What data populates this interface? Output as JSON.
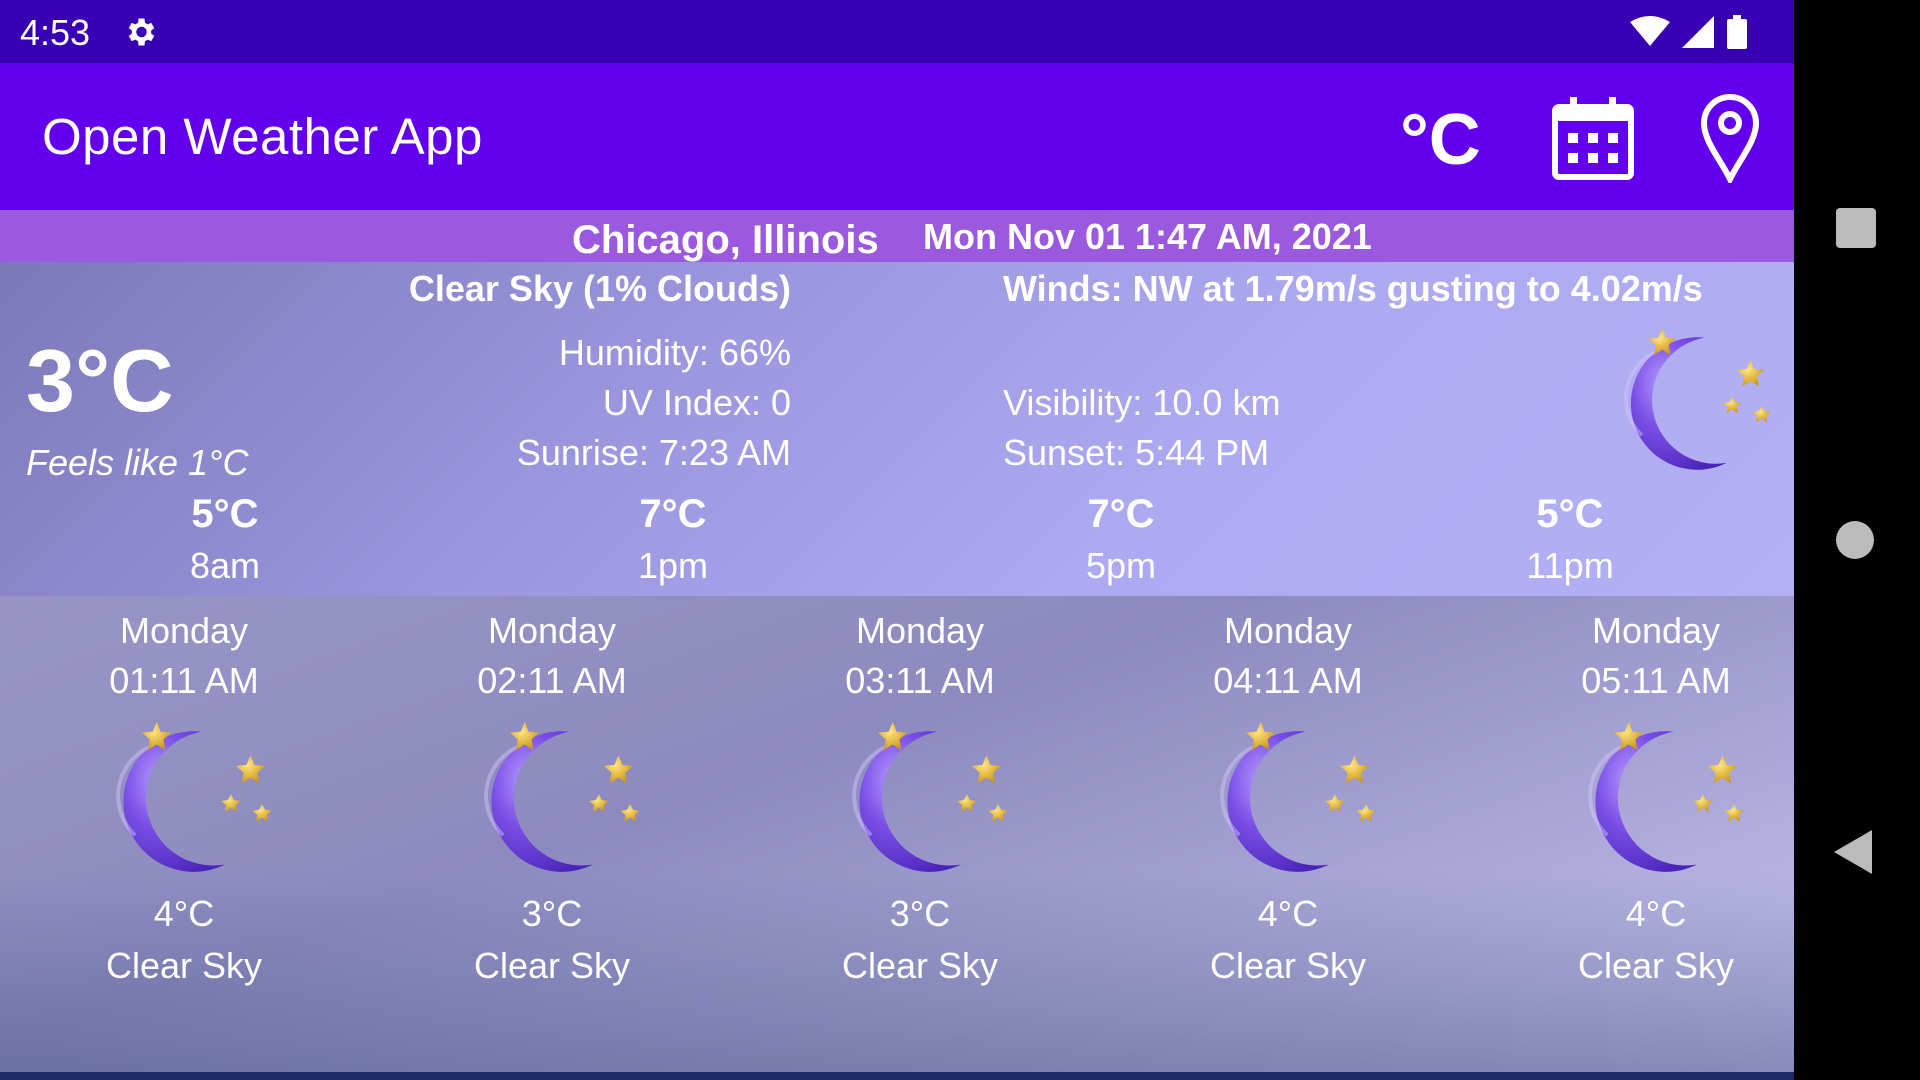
{
  "status_bar": {
    "time": "4:53"
  },
  "app_bar": {
    "title": "Open Weather App",
    "unit_label": "°C"
  },
  "location": {
    "city": "Chicago, Illinois",
    "datetime": "Mon Nov 01 1:47 AM, 2021"
  },
  "current": {
    "condition": "Clear Sky (1% Clouds)",
    "winds": "Winds: NW at 1.79m/s gusting to 4.02m/s",
    "temperature": "3°C",
    "feels_like": "Feels like 1°C",
    "humidity": "Humidity: 66%",
    "uv_index": "UV Index: 0",
    "sunrise": "Sunrise: 7:23 AM",
    "visibility": "Visibility: 10.0 km",
    "sunset": "Sunset: 5:44 PM",
    "icon": "moon-stars-icon"
  },
  "day_parts": [
    {
      "temp": "5°C",
      "label": "8am"
    },
    {
      "temp": "7°C",
      "label": "1pm"
    },
    {
      "temp": "7°C",
      "label": "5pm"
    },
    {
      "temp": "5°C",
      "label": "11pm"
    }
  ],
  "forecast": [
    {
      "day": "Monday",
      "time": "01:11 AM",
      "temp": "4°C",
      "condition": "Clear Sky",
      "icon": "moon-stars-icon"
    },
    {
      "day": "Monday",
      "time": "02:11 AM",
      "temp": "3°C",
      "condition": "Clear Sky",
      "icon": "moon-stars-icon"
    },
    {
      "day": "Monday",
      "time": "03:11 AM",
      "temp": "3°C",
      "condition": "Clear Sky",
      "icon": "moon-stars-icon"
    },
    {
      "day": "Monday",
      "time": "04:11 AM",
      "temp": "4°C",
      "condition": "Clear Sky",
      "icon": "moon-stars-icon"
    },
    {
      "day": "Monday",
      "time": "05:11 AM",
      "temp": "4°C",
      "condition": "Clear Sky",
      "icon": "moon-stars-icon"
    }
  ],
  "colors": {
    "status_bar": "#3700b3",
    "app_bar": "#6200ee",
    "header_strip": "#9b59e0",
    "moon": "#7b4fe6",
    "star": "#e6b422"
  }
}
